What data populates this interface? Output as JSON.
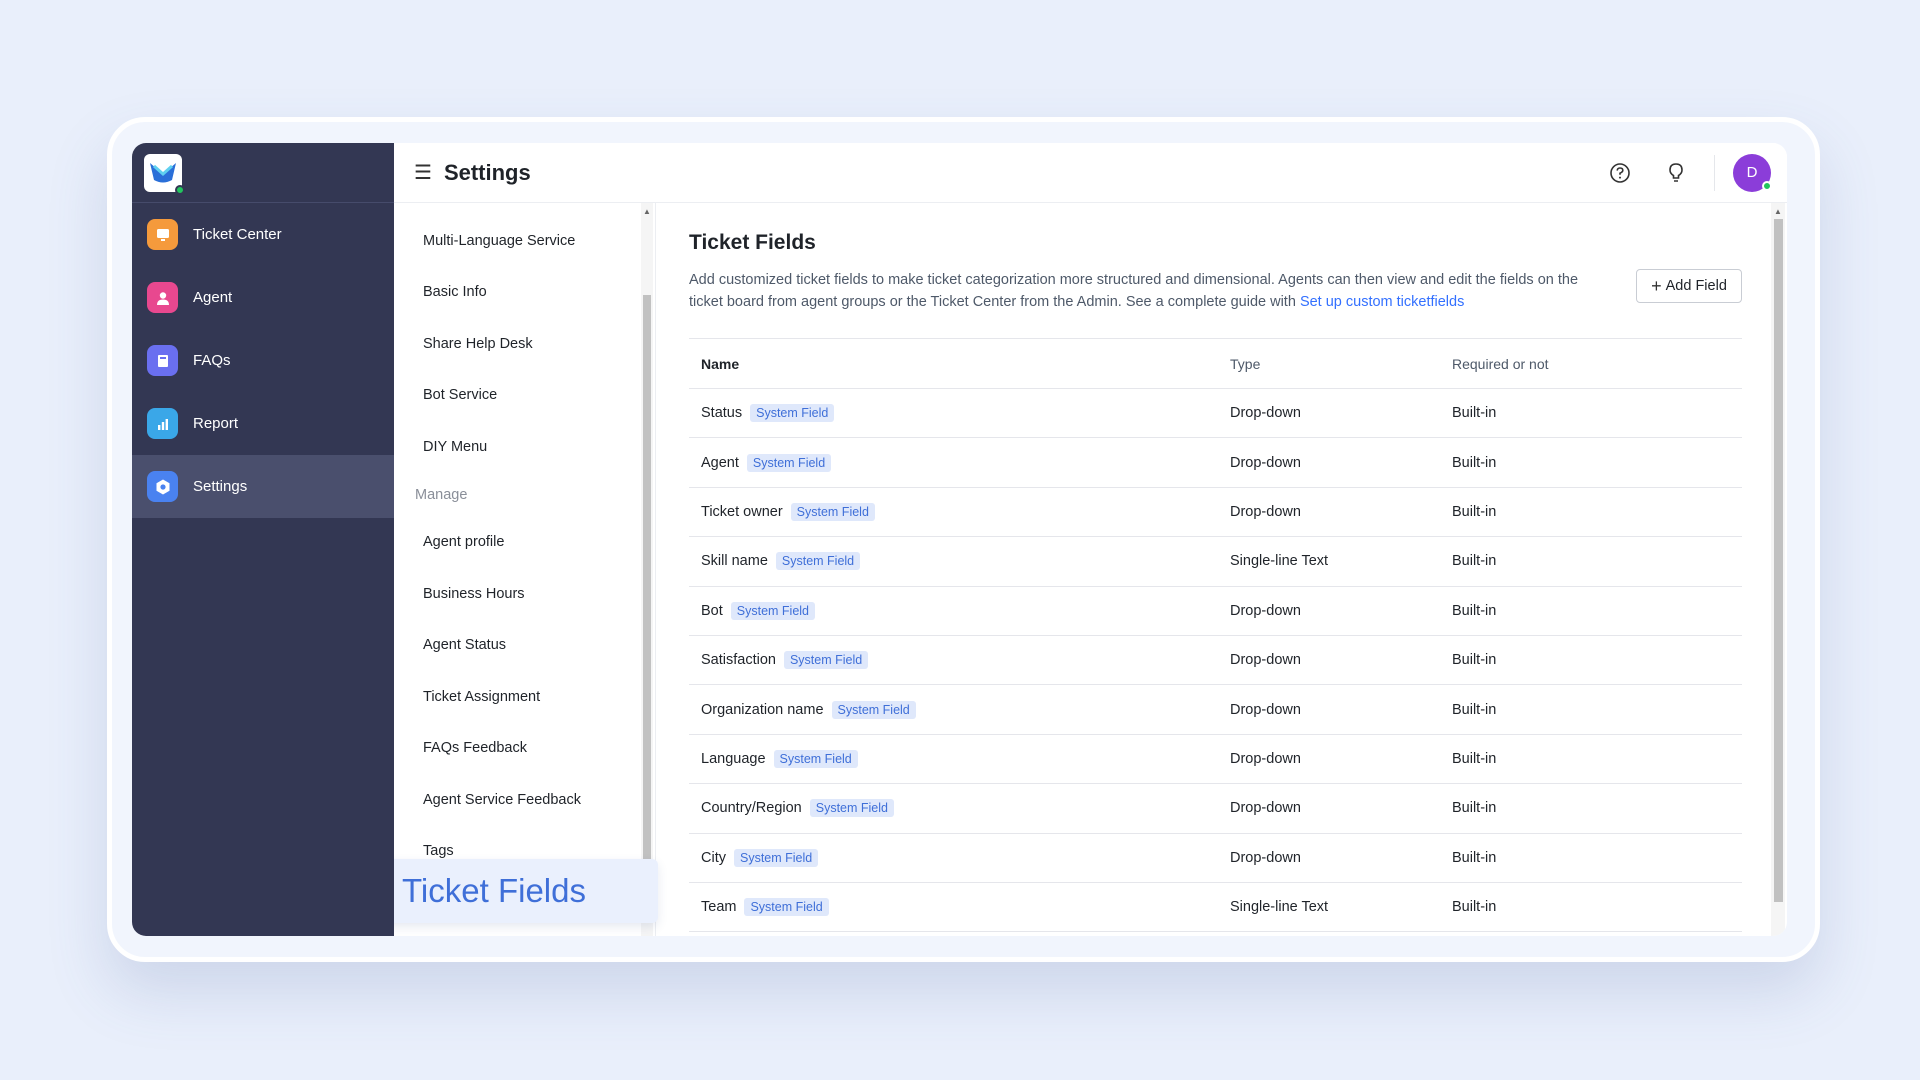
{
  "nav": {
    "items": [
      {
        "label": "Ticket Center",
        "icon": "monitor-icon",
        "color": "#f59a3c"
      },
      {
        "label": "Agent",
        "icon": "user-icon",
        "color": "#e8488f"
      },
      {
        "label": "FAQs",
        "icon": "book-icon",
        "color": "#6a6ff0"
      },
      {
        "label": "Report",
        "icon": "bar-chart-icon",
        "color": "#3aa7e8"
      },
      {
        "label": "Settings",
        "icon": "gear-icon",
        "color": "#4a82f0"
      }
    ],
    "active": "Settings"
  },
  "header": {
    "title": "Settings",
    "avatar_initial": "D"
  },
  "submenu": {
    "items_top": [
      "Multi-Language Service",
      "Basic Info",
      "Share Help Desk",
      "Bot Service",
      "DIY Menu"
    ],
    "group_label": "Manage",
    "items_manage": [
      "Agent profile",
      "Business Hours",
      "Agent Status",
      "Ticket Assignment",
      "FAQs Feedback",
      "Agent Service Feedback",
      "Tags"
    ],
    "highlighted": "Ticket Fields"
  },
  "content": {
    "title": "Ticket Fields",
    "description": "Add customized ticket fields to make ticket categorization more structured and dimensional. Agents can then view and edit the fields on the ticket board from agent groups or the Ticket Center from the Admin. See a complete guide with ",
    "guide_link": "Set up custom ticketfields",
    "add_button": "Add Field",
    "table": {
      "headers": [
        "Name",
        "Type",
        "Required or not"
      ],
      "badge_label": "System Field",
      "rows": [
        {
          "name": "Status",
          "type": "Drop-down",
          "required": "Built-in"
        },
        {
          "name": "Agent",
          "type": "Drop-down",
          "required": "Built-in"
        },
        {
          "name": "Ticket owner",
          "type": "Drop-down",
          "required": "Built-in"
        },
        {
          "name": "Skill name",
          "type": "Single-line Text",
          "required": "Built-in"
        },
        {
          "name": "Bot",
          "type": "Drop-down",
          "required": "Built-in"
        },
        {
          "name": "Satisfaction",
          "type": "Drop-down",
          "required": "Built-in"
        },
        {
          "name": "Organization name",
          "type": "Drop-down",
          "required": "Built-in"
        },
        {
          "name": "Language",
          "type": "Drop-down",
          "required": "Built-in"
        },
        {
          "name": "Country/Region",
          "type": "Drop-down",
          "required": "Built-in"
        },
        {
          "name": "City",
          "type": "Drop-down",
          "required": "Built-in"
        },
        {
          "name": "Team",
          "type": "Single-line Text",
          "required": "Built-in"
        }
      ]
    }
  }
}
